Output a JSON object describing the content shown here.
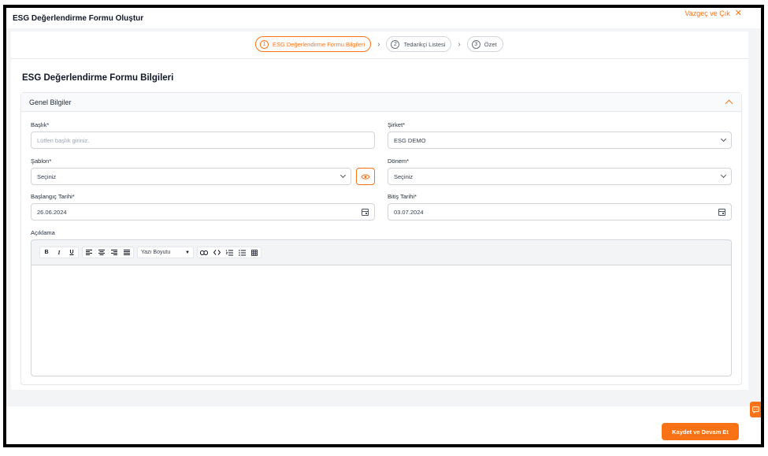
{
  "window": {
    "title": "ESG Değerlendirme Formu Oluştur",
    "cancel_label": "Vazgeç ve Çık"
  },
  "steps": [
    {
      "number": "1",
      "label": "ESG Değerlendirme Formu Bilgileri",
      "active": true
    },
    {
      "number": "2",
      "label": "Tedarikçi Listesi",
      "active": false
    },
    {
      "number": "3",
      "label": "Özet",
      "active": false
    }
  ],
  "section": {
    "title": "ESG Değerlendirme Formu Bilgileri",
    "card_title": "Genel Bilgiler"
  },
  "form": {
    "baslik": {
      "label": "Başlık*",
      "placeholder": "Lütfen başlık giriniz.",
      "value": ""
    },
    "sirket": {
      "label": "Şirket*",
      "value": "ESG DEMO"
    },
    "sablon": {
      "label": "Şablon*",
      "value": "Seçiniz"
    },
    "donem": {
      "label": "Dönem*",
      "value": "Seçiniz"
    },
    "baslangic": {
      "label": "Başlangıç Tarihi*",
      "value": "26.06.2024"
    },
    "bitis": {
      "label": "Bitiş Tarihi*",
      "value": "03.07.2024"
    },
    "aciklama": {
      "label": "Açıklama"
    }
  },
  "editor": {
    "bold": "B",
    "italic": "I",
    "underline": "U",
    "font_size_label": "Yazı Boyutu"
  },
  "footer": {
    "save_label": "Kaydet ve Devam Et"
  },
  "colors": {
    "accent": "#f97316",
    "border": "#d1d5db",
    "background": "#f3f4f6"
  }
}
